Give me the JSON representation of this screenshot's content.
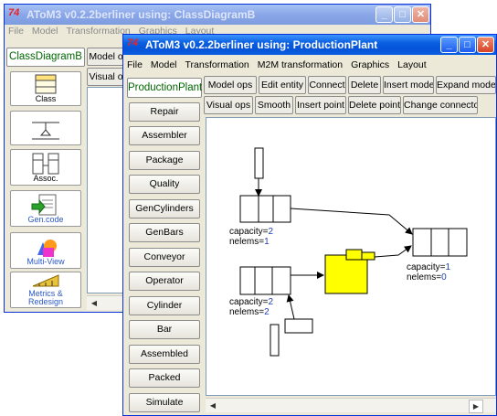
{
  "back_window": {
    "title": "AToM3 v0.2.2berliner using: ClassDiagramB",
    "menu": [
      "File",
      "Model",
      "Transformation",
      "Graphics",
      "Layout"
    ],
    "active_tab": "ClassDiagramB",
    "toolbar": [
      "Model op",
      "Visual op"
    ],
    "palette": [
      {
        "label": "Class",
        "icon": "class-icon"
      },
      {
        "label": "",
        "icon": "inheritance-icon"
      },
      {
        "label": "Assoc.",
        "icon": "association-icon"
      },
      {
        "label": "Gen.code",
        "icon": "gen-code-icon"
      },
      {
        "label": "Multi-View",
        "icon": "multi-view-icon"
      },
      {
        "label": "Metrics & Redesign",
        "icon": "metrics-icon"
      }
    ]
  },
  "front_window": {
    "title": "AToM3 v0.2.2berliner using: ProductionPlant",
    "menu": [
      "File",
      "Model",
      "Transformation",
      "M2M transformation",
      "Graphics",
      "Layout"
    ],
    "active_tab": "ProductionPlant",
    "toolbar_row1": [
      "Model ops",
      "Edit entity",
      "Connect",
      "Delete",
      "Insert model",
      "Expand model"
    ],
    "toolbar_row2": [
      "Visual ops",
      "Smooth",
      "Insert point",
      "Delete point",
      "Change connector"
    ],
    "palette": [
      "Repair",
      "Assembler",
      "Package",
      "Quality",
      "GenCylinders",
      "GenBars",
      "Conveyor",
      "Operator",
      "Cylinder",
      "Bar",
      "Assembled",
      "Packed",
      "Simulate"
    ]
  },
  "diagram": {
    "conveyor1": {
      "capacity_label": "capacity=",
      "capacity": "2",
      "nelems_label": "nelems=",
      "nelems": "1"
    },
    "conveyor2": {
      "capacity_label": "capacity=",
      "capacity": "2",
      "nelems_label": "nelems=",
      "nelems": "2"
    },
    "conveyor3": {
      "capacity_label": "capacity=",
      "capacity": "1",
      "nelems_label": "nelems=",
      "nelems": "0"
    },
    "colors": {
      "assembler_fill": "#ffff00",
      "app_icon": "#ee2222"
    }
  }
}
